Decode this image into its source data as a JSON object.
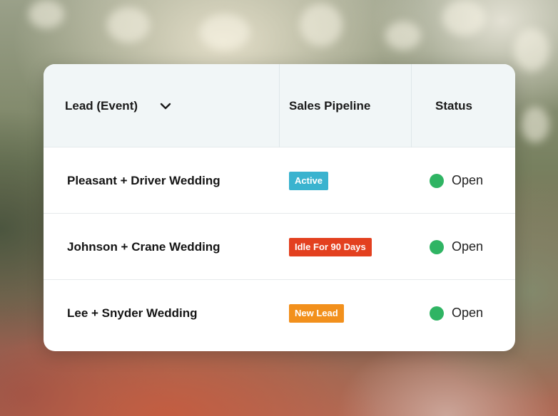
{
  "table": {
    "headers": {
      "lead": "Lead (Event)",
      "pipeline": "Sales Pipeline",
      "status": "Status"
    },
    "rows": [
      {
        "lead": "Pleasant + Driver Wedding",
        "pipeline": "Active",
        "pipeline_color": "#3ab3cf",
        "status": "Open",
        "status_color": "#2fb463"
      },
      {
        "lead": "Johnson + Crane Wedding",
        "pipeline": "Idle For 90 Days",
        "pipeline_color": "#e3401f",
        "status": "Open",
        "status_color": "#2fb463"
      },
      {
        "lead": "Lee + Snyder Wedding",
        "pipeline": "New Lead",
        "pipeline_color": "#f2901c",
        "status": "Open",
        "status_color": "#2fb463"
      }
    ]
  }
}
